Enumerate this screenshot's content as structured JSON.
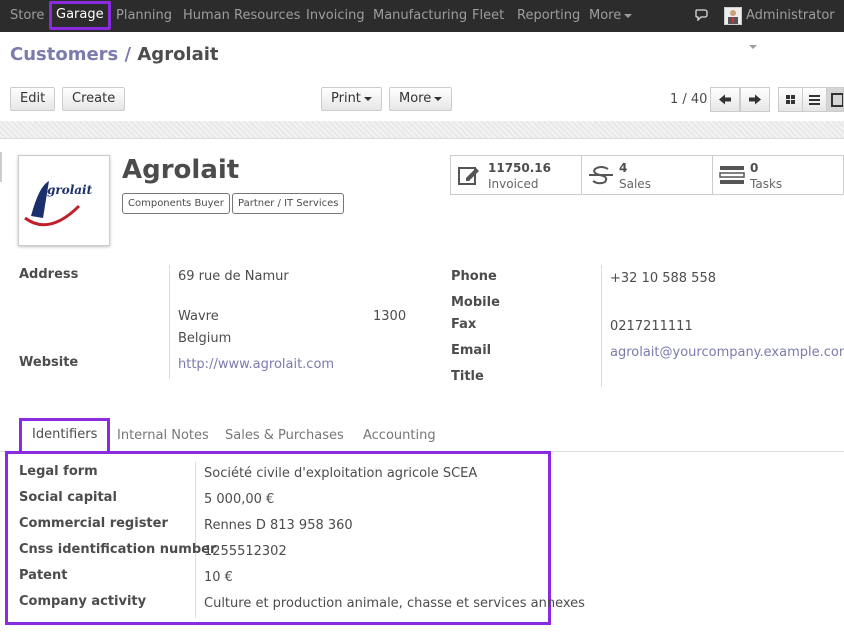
{
  "topbar": {
    "menu": [
      "Store",
      "Garage",
      "Planning",
      "Human Resources",
      "Invoicing",
      "Manufacturing",
      "Fleet",
      "Reporting",
      "More"
    ],
    "user": "Administrator"
  },
  "breadcrumb": {
    "parent": "Customers",
    "sep": " / ",
    "current": "Agrolait"
  },
  "toolbar": {
    "edit": "Edit",
    "create": "Create",
    "print": "Print",
    "more": "More",
    "pager": "1 / 40"
  },
  "partner": {
    "name": "Agrolait",
    "logo_text": "grolait",
    "tags": [
      "Components Buyer",
      "Partner / IT Services"
    ]
  },
  "stats": [
    {
      "value": "11750.16",
      "label": "Invoiced",
      "icon": "invoice-icon"
    },
    {
      "value": "4",
      "label": "Sales",
      "icon": "sales-icon"
    },
    {
      "value": "0",
      "label": "Tasks",
      "icon": "tasks-icon"
    }
  ],
  "fields": {
    "address_label": "Address",
    "street": "69 rue de Namur",
    "city": "Wavre",
    "zip": "1300",
    "country": "Belgium",
    "website_label": "Website",
    "website": "http://www.agrolait.com",
    "phone_label": "Phone",
    "phone": "+32 10 588 558",
    "mobile_label": "Mobile",
    "fax_label": "Fax",
    "fax": "0217211111",
    "email_label": "Email",
    "email": "agrolait@yourcompany.example.com",
    "title_label": "Title"
  },
  "tabs": [
    "Identifiers",
    "Internal Notes",
    "Sales & Purchases",
    "Accounting"
  ],
  "identifiers": [
    {
      "label": "Legal form",
      "value": "Société civile d'exploitation agricole SCEA"
    },
    {
      "label": "Social capital",
      "value": "5 000,00 €"
    },
    {
      "label": "Commercial register",
      "value": "Rennes D 813 958 360"
    },
    {
      "label": "Cnss identification number",
      "value": "1255512302"
    },
    {
      "label": "Patent",
      "value": "10 €"
    },
    {
      "label": "Company activity",
      "value": "Culture et production animale, chasse et services annexes"
    }
  ],
  "colors": {
    "accent": "#7c7bad",
    "highlight": "#8a2be2",
    "topbar": "#2c2c2c"
  }
}
